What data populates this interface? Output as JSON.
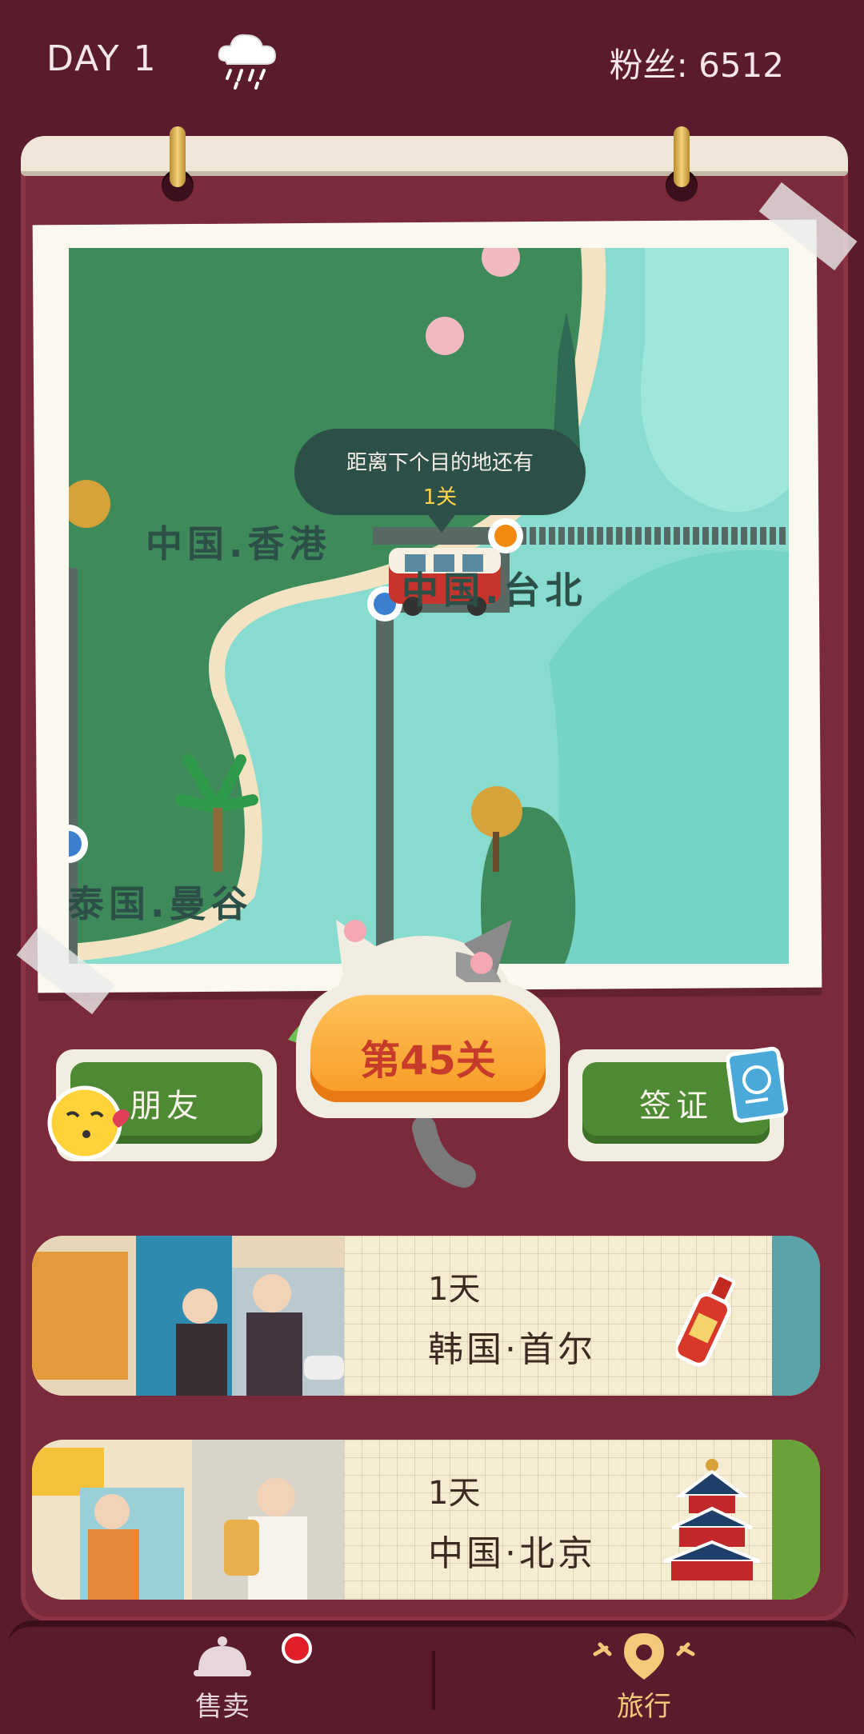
{
  "header": {
    "day": "DAY 1",
    "weather_icon": "rain-cloud-icon",
    "fans": "粉丝: 6512"
  },
  "map": {
    "tooltip_line1": "距离下个目的地还有",
    "tooltip_line2": "1关",
    "places": [
      "中国.香港",
      "中国.台北",
      "泰国.曼谷"
    ]
  },
  "buttons": {
    "friends": "朋友",
    "level": "第45关",
    "visa": "签证"
  },
  "trips": [
    {
      "days": "1天",
      "destination": "韩国·首尔",
      "item_icon": "hot-sauce-bottle-icon"
    },
    {
      "days": "1天",
      "destination": "中国·北京",
      "item_icon": "temple-of-heaven-icon"
    }
  ],
  "nav": {
    "sell": "售卖",
    "travel": "旅行"
  },
  "colors": {
    "background": "#5a1c2c",
    "board": "#7a2a3a",
    "sea": "#87dccf",
    "land": "#3f8a5a",
    "accent": "#f79b22"
  }
}
